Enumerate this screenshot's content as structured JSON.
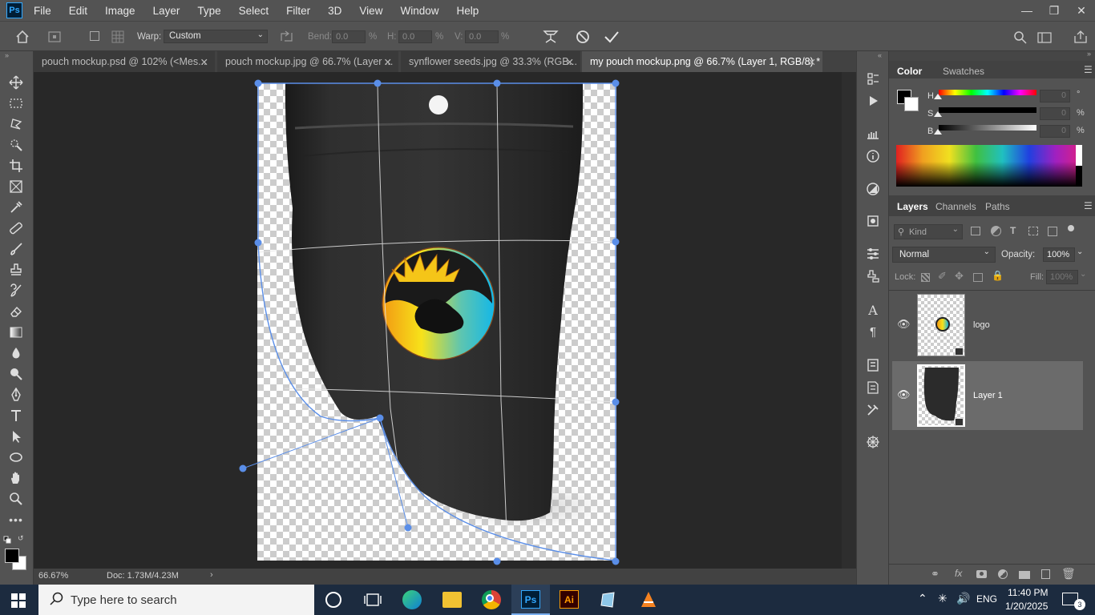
{
  "app": {
    "logo": "Ps"
  },
  "menu": [
    "File",
    "Edit",
    "Image",
    "Layer",
    "Type",
    "Select",
    "Filter",
    "3D",
    "View",
    "Window",
    "Help"
  ],
  "options": {
    "warp_label": "Warp:",
    "warp_value": "Custom",
    "bend_label": "Bend:",
    "bend_value": "0.0",
    "bend_unit": "%",
    "h_label": "H:",
    "h_value": "0.0",
    "h_unit": "%",
    "v_label": "V:",
    "v_value": "0.0",
    "v_unit": "%"
  },
  "tabs": [
    {
      "label": "pouch mockup.psd @ 102% (<Mes...",
      "active": false
    },
    {
      "label": "pouch mockup.jpg @ 66.7% (Layer ...",
      "active": false
    },
    {
      "label": "synflower seeds.jpg @ 33.3% (RGB...",
      "active": false
    },
    {
      "label": "my pouch mockup.png @ 66.7% (Layer 1, RGB/8) *",
      "active": true
    }
  ],
  "status": {
    "zoom": "66.67%",
    "doc": "Doc: 1.73M/4.23M"
  },
  "color_panel": {
    "tabs": [
      "Color",
      "Swatches"
    ],
    "h_label": "H",
    "s_label": "S",
    "b_label": "B",
    "h_value": "0",
    "s_value": "0",
    "b_value": "0",
    "h_unit": "°",
    "s_unit": "%",
    "b_unit": "%"
  },
  "layers_panel": {
    "tabs": [
      "Layers",
      "Channels",
      "Paths"
    ],
    "kind_placeholder": "Kind",
    "blend_mode": "Normal",
    "opacity_label": "Opacity:",
    "opacity_value": "100%",
    "lock_label": "Lock:",
    "fill_label": "Fill:",
    "fill_value": "100%",
    "layers": [
      {
        "name": "logo",
        "selected": false
      },
      {
        "name": "Layer 1",
        "selected": true
      }
    ]
  },
  "taskbar": {
    "search_placeholder": "Type here to search",
    "ai_label": "Ai",
    "ps_label": "Ps",
    "lang": "ENG",
    "time": "11:40 PM",
    "date": "1/20/2025",
    "notifications": "3"
  }
}
